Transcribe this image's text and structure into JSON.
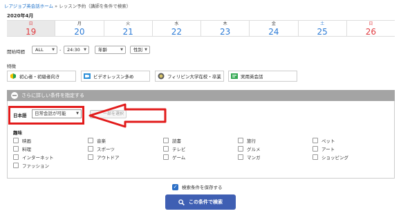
{
  "breadcrumb": {
    "home": "レアジョブ英会話ホーム",
    "separator": "»",
    "current": "レッスン予約（講師を条件で検索）"
  },
  "calendar": {
    "month": "2020年4月",
    "days": [
      {
        "dow": "日",
        "date": "19",
        "selected": true
      },
      {
        "dow": "月",
        "date": "20"
      },
      {
        "dow": "火",
        "date": "21"
      },
      {
        "dow": "水",
        "date": "22"
      },
      {
        "dow": "木",
        "date": "23"
      },
      {
        "dow": "金",
        "date": "24"
      },
      {
        "dow": "土",
        "date": "25"
      },
      {
        "dow": "日",
        "date": "26"
      }
    ]
  },
  "filters": {
    "start_time_label": "開始時間",
    "start_value": "ALL",
    "dash": "-",
    "end_value": "24:30",
    "age_value": "年齢",
    "gender_value": "性別"
  },
  "features": {
    "title": "特徴",
    "items": [
      {
        "label": "初心者・初級者向き",
        "icon": "beginner-leaf-icon"
      },
      {
        "label": "ビデオレッスン多め",
        "icon": "video-icon"
      },
      {
        "label": "フィリピン大学在校・卒業",
        "icon": "university-seal-icon"
      },
      {
        "label": "実用英会話",
        "icon": "conversation-icon"
      }
    ]
  },
  "advanced": {
    "toggle_label": "さらに詳しい条件を指定する",
    "japanese_label": "日本語",
    "japanese_value": "日常会話が可能",
    "partial_button": "一部を選択"
  },
  "hobbies": {
    "title": "趣味",
    "items": [
      "映画",
      "音楽",
      "読書",
      "旅行",
      "ペット",
      "料理",
      "スポーツ",
      "テレビ",
      "グルメ",
      "アート",
      "インターネット",
      "アウトドア",
      "ゲーム",
      "マンガ",
      "ショッピング",
      "ファッション"
    ]
  },
  "save_conditions": {
    "label": "検索条件を保存する",
    "checked": true
  },
  "search_button": "この条件で検索",
  "colors": {
    "annotation": "#e21b1b",
    "accent": "#2a7ad6",
    "sunday": "#e0393e",
    "button": "#3f5fb3"
  }
}
